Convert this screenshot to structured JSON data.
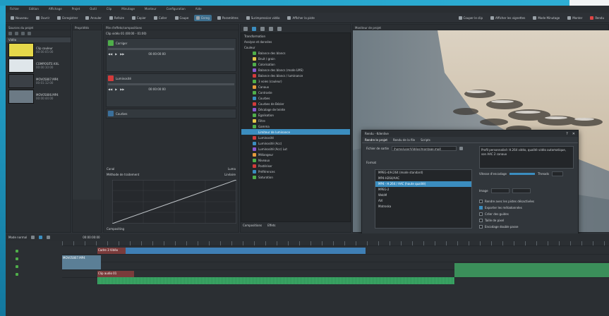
{
  "menu": [
    "Fichier",
    "Edition",
    "Affichage",
    "Projet",
    "Outil",
    "Clip",
    "Minutage",
    "Monteur",
    "Configuration",
    "Aide"
  ],
  "toolbar": {
    "items": [
      "Nouveau",
      "Ouvrir",
      "Enregistrer",
      "Annuler",
      "Refaire",
      "Copier",
      "Coller",
      "Coupe",
      "Enreg",
      "Paramètres",
      "Surimpression vidéo",
      "Afficher la piste"
    ],
    "items_right": [
      "Couper le clip",
      "Afficher les vignettes",
      "Mode Minutage",
      "Monter",
      "Rendu"
    ]
  },
  "project_bin": {
    "title": "Sources du projet",
    "folder": "Vidéo",
    "clips": [
      {
        "name": "Clip couleur",
        "sub": "00:00:05:00"
      },
      {
        "name": "COMPOSITE-XXL",
        "sub": "00:00:10:00"
      },
      {
        "name": "MOV05807.MP4",
        "sub": "00:01:12:00"
      },
      {
        "name": "MOV05806.MP4",
        "sub": "00:00:44:00"
      }
    ]
  },
  "properties": {
    "title": "Propriétés",
    "subtitle": "Piste audio",
    "tabs": [
      "Clip",
      "Effet"
    ]
  },
  "effect_stack": {
    "title": "Pile d'effets/compositions",
    "clip": "Clip vidéo 01 (00:00 - 01:00)",
    "effects": [
      {
        "name": "Corriger",
        "color": "#4fae4a",
        "time": "00:00:00:00"
      },
      {
        "name": "Luminosité",
        "color": "#d33b3b",
        "time": "00:00:00:00"
      },
      {
        "name": "Courbes",
        "color": "#3b6f9a",
        "time": ""
      }
    ],
    "param_a": "Canal",
    "param_a_val": "Luma",
    "param_b": "Méthode de traitement",
    "param_b_val": "Linéaire",
    "bottom": "Compositing"
  },
  "effects_list": {
    "categories": [
      "Transformation",
      "Analyse et données",
      "Couleur"
    ],
    "items": [
      {
        "name": "Balance des blancs",
        "color": "#4fae4a"
      },
      {
        "name": "Bruit / grain",
        "color": "#e5c64a"
      },
      {
        "name": "Colorisation",
        "color": "#4fae4a"
      },
      {
        "name": "Balance des blancs (mode LMS)",
        "color": "#8a5ad1"
      },
      {
        "name": "Balance des blancs / luminance",
        "color": "#d33b3b"
      },
      {
        "name": "3 voies (couleur)",
        "color": "#4fae4a"
      },
      {
        "name": "Canaux",
        "color": "#e59a3a"
      },
      {
        "name": "Contraste",
        "color": "#4fae4a"
      },
      {
        "name": "Courbes",
        "color": "#3b8dbf"
      },
      {
        "name": "Courbes de Bézier",
        "color": "#d33b3b"
      },
      {
        "name": "Décalage de teinte",
        "color": "#8a5ad1"
      },
      {
        "name": "Égalisation",
        "color": "#4fae4a"
      },
      {
        "name": "Filtre",
        "color": "#e5c64a"
      },
      {
        "name": "Gamma",
        "color": "#4fae4a"
      },
      {
        "name": "Limiteur de luminance",
        "color": "#3b8dbf"
      },
      {
        "name": "Luminosité",
        "color": "#d33b3b"
      },
      {
        "name": "Luminosité (Acc)",
        "color": "#3b8dbf"
      },
      {
        "name": "Luminosité (Acc) Lut",
        "color": "#8a5ad1"
      },
      {
        "name": "Mélangeur",
        "color": "#e59a3a"
      },
      {
        "name": "Niveaux",
        "color": "#4fae4a"
      },
      {
        "name": "Postériser",
        "color": "#d33b3b"
      },
      {
        "name": "Préférences",
        "color": "#3b8dbf"
      },
      {
        "name": "Saturation",
        "color": "#4fae4a"
      }
    ],
    "selected_index": 14,
    "footer_tabs": [
      "Compositions",
      "Effets"
    ]
  },
  "monitor": {
    "title": "Moniteur de projet"
  },
  "render": {
    "title": "Rendu - Kdenlive",
    "tabs": [
      "Rendre le projet",
      "Rendu de la file",
      "Scripts"
    ],
    "output_label": "Fichier de sortie",
    "output_value": "/home/user/Vidéos/montage.mp4",
    "format_label": "Format",
    "formats": [
      {
        "name": "MPEG-4/H.264 (mode standard)",
        "sel": false
      },
      {
        "name": "MP4-H264/AAC",
        "sel": false
      },
      {
        "name": "MP4 - H.264 / AAC (haute qualité)",
        "sel": true
      },
      {
        "name": "MPEG-2",
        "sel": false
      },
      {
        "name": "WebM",
        "sel": false
      },
      {
        "name": "AVI",
        "sel": false
      },
      {
        "name": "Matroska",
        "sel": false
      }
    ],
    "quality_label": "Qualité",
    "quality_value": "Kbits",
    "radio_full": "Projet complet",
    "radio_zone": "Zone sélectionnée",
    "radio_guides": "Plus d'options",
    "chk_script": "Scripter",
    "btn_render": "Rendu vers fichier",
    "btn_script": "Générer le script",
    "btn_close": "Fermer",
    "desc": "Profil personnalisé: H.264 vidéo, qualité vidéo automatique, son AAC 2 canaux",
    "fps_label": "Image",
    "options": [
      "Rendre avec les pistes désactivées",
      "Exporter les métadonnées",
      "Créer des guides",
      "Taille de pixel",
      "Encodage double passe"
    ],
    "speed_label": "Vitesse d'encodage",
    "threads_label": "Threads"
  },
  "timeline": {
    "mode": "Mode normal",
    "timecode": "00:00:00:00",
    "clip_label": "Cadre 3 Vidéo",
    "video_clip": "MOV05807.MP4",
    "audio_clip": "Clip audio 01"
  },
  "colors": {
    "accent": "#3b8dbf",
    "panel": "#2b2f33"
  }
}
